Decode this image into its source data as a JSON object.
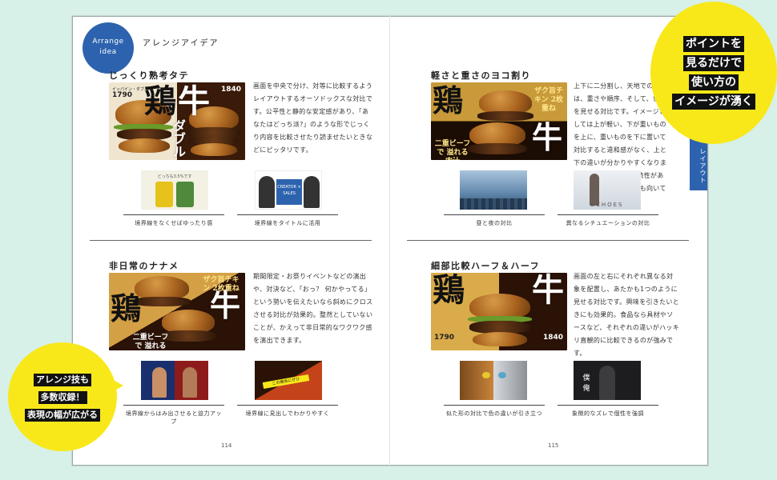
{
  "header": {
    "badge": "Arrange idea",
    "badge_line1": "Arrange",
    "badge_line2": "idea",
    "title": "アレンジアイデア"
  },
  "side_tab": "レイアウト",
  "bubbles": {
    "top_right": [
      "ポイントを",
      "見るだけで",
      "使い方の",
      "イメージが湧く"
    ],
    "bottom_left": [
      "アレンジ技も",
      "多数収録！",
      "表現の幅が広がる"
    ]
  },
  "hero_text": {
    "chicken": "鶏",
    "beef": "牛",
    "double": "ダブル",
    "tag_chicken": "ザク旨チキン 2枚重ね",
    "tag_beef": "二重ビーフで 溢れる肉汁",
    "price1": "1790",
    "price2": "1840",
    "price_label1": "イッパイン・ダブルバーガー",
    "price_label2": "イッパイン・ダブルバーガー"
  },
  "sections": [
    {
      "title": "じっくり熟考タテ",
      "text": "画面を中央で分け、対等に比較するようレイアウトするオーソドックスな対比です。公平性と静的な安定感があり、「あなたはどっち派?」のような形でじっくり内容を比較させたり読ませたいときなどにピッタリです。",
      "examples": [
        {
          "caption": "境界線をなくせばゆったり感",
          "label": "どっちも3.5%です"
        },
        {
          "caption": "境界線をタイトルに活用",
          "label": "CREATOR × SALES"
        }
      ]
    },
    {
      "title": "軽さと重さのヨコ割り",
      "text": "上下に二分割し、天地での対比は、重さや順序、そして、世界を見せる対比です。イメージとしては上が軽い、下が重いものを上に、重いものを下に置いて対比すると違和感がなく、上と下の違いが分かりやすくなります。上下の2コマで連続性があり、ストーリー表現にも向いています。",
      "examples": [
        {
          "caption": "昼と夜の対比",
          "label": "city"
        },
        {
          "caption": "異なるシチュエーションの対比",
          "label": "ECHOES"
        }
      ]
    },
    {
      "title": "非日常のナナメ",
      "text": "期間限定・お祭りイベントなどの演出や、対決など、「おっ？ 何かやってる」という勢いを伝えたいなら斜めにクロスさせる対比が効果的。整然としていないことが、かえって非日常的なワクワク感を演出できます。",
      "examples": [
        {
          "caption": "境界線からはみ出させると迫力アップ",
          "label": "boxing"
        },
        {
          "caption": "境界線に見出しでわかりやすく",
          "label": "この機会にぜひ"
        }
      ]
    },
    {
      "title": "細部比較ハーフ＆ハーフ",
      "text": "画面の左と右にそれぞれ異なる対象を配置し、あたかも1つのように見せる対比です。興味を引きたいときにも効果的。食品なら具材やソースなど、それぞれの違いがハッキリ直観的に比較できるのが強みです。",
      "examples": [
        {
          "caption": "似た形の対比で色の違いが引き立つ",
          "label": "tiger"
        },
        {
          "caption": "象徴的なズレで個性を強調",
          "label": "僕 俺"
        }
      ]
    }
  ],
  "pages": {
    "left": "114",
    "right": "115"
  },
  "colors": {
    "background": "#d7f0e8",
    "accent_blue": "#2d63ae",
    "bubble_yellow": "#f8e81a",
    "hero_brown": "#3a1a08"
  }
}
